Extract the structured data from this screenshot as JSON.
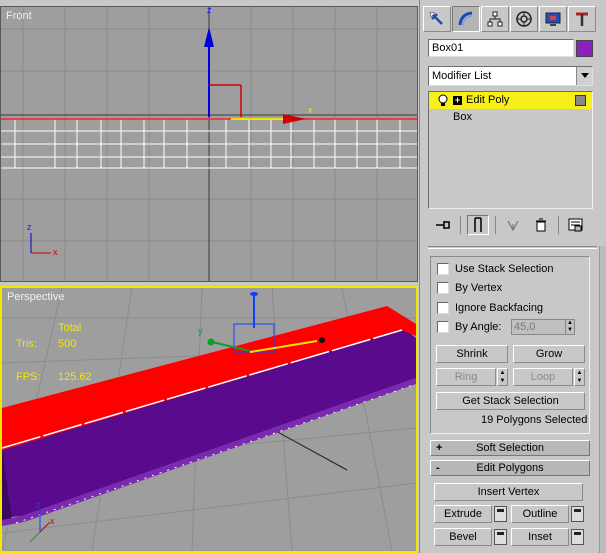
{
  "viewports": {
    "front": {
      "label": "Front",
      "axis_x": "x",
      "axis_z": "z"
    },
    "perspective": {
      "label": "Perspective",
      "stats_header": "Total",
      "tris_label": "Tris:",
      "tris_value": "500",
      "fps_label": "FPS:",
      "fps_value": "125.62",
      "axis_x": "x",
      "axis_y": "y",
      "axis_z": "z"
    }
  },
  "command_panel": {
    "tabs": [
      {
        "icon": "create-icon"
      },
      {
        "icon": "modify-icon"
      },
      {
        "icon": "hierarchy-icon"
      },
      {
        "icon": "motion-icon"
      },
      {
        "icon": "display-icon"
      },
      {
        "icon": "utilities-icon"
      }
    ],
    "object_name": "Box01",
    "object_color": "#8e1fbf",
    "modifier_list": "Modifier List",
    "stack": {
      "items": [
        {
          "label": "Edit Poly",
          "selected": true
        },
        {
          "label": "Box",
          "selected": false
        }
      ]
    }
  },
  "selection": {
    "use_stack_selection": "Use Stack Selection",
    "by_vertex": "By Vertex",
    "ignore_backfacing": "Ignore Backfacing",
    "by_angle": "By Angle:",
    "by_angle_value": "45,0",
    "shrink": "Shrink",
    "grow": "Grow",
    "ring": "Ring",
    "loop": "Loop",
    "get_stack_selection": "Get Stack Selection",
    "status": "19 Polygons Selected"
  },
  "rollouts": {
    "soft_selection": {
      "sign": "+",
      "title": "Soft Selection"
    },
    "edit_polygons": {
      "sign": "-",
      "title": "Edit Polygons"
    }
  },
  "edit_polygons": {
    "insert_vertex": "Insert Vertex",
    "extrude": "Extrude",
    "outline": "Outline",
    "bevel": "Bevel",
    "inset": "Inset"
  },
  "colors": {
    "selection_yellow": "#f7ef1a",
    "poly_red": "#ff0000",
    "poly_purple": "#5a0a8c",
    "viewport_bg": "#9e9e9e"
  }
}
